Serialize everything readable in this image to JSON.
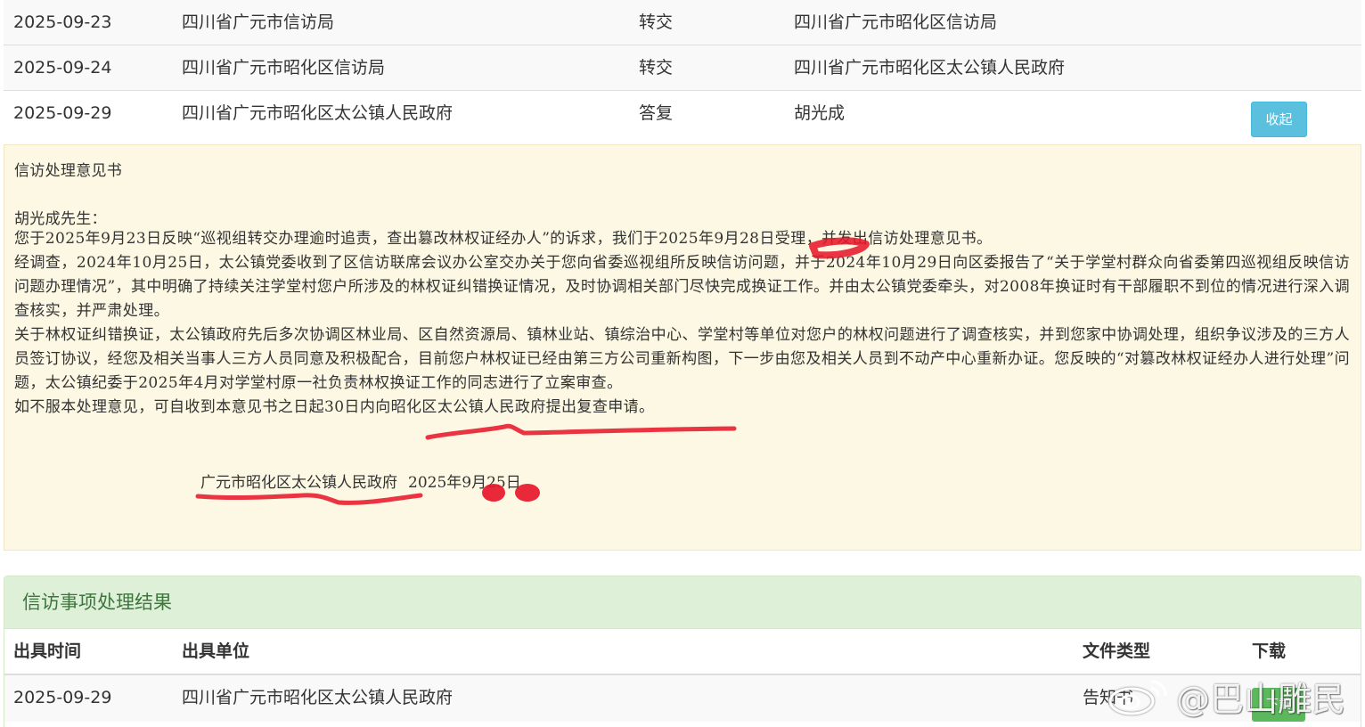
{
  "flow": {
    "rows": [
      {
        "date": "2025-09-23",
        "from": "四川省广元市信访局",
        "action": "转交",
        "to": "四川省广元市昭化区信访局"
      },
      {
        "date": "2025-09-24",
        "from": "四川省广元市昭化区信访局",
        "action": "转交",
        "to": "四川省广元市昭化区太公镇人民政府"
      },
      {
        "date": "2025-09-29",
        "from": "四川省广元市昭化区太公镇人民政府",
        "action": "答复",
        "to": "胡光成"
      }
    ],
    "collapse_label": "收起"
  },
  "opinion": {
    "title": "信访处理意见书",
    "salutation": "胡光成先生：",
    "paragraphs": [
      "您于2025年9月23日反映“巡视组转交办理逾时追责，查出篡改林权证经办人”的诉求，我们于2025年9月28日受理，并发出信访处理意见书。",
      "经调查，2024年10月25日，太公镇党委收到了区信访联席会议办公室交办关于您向省委巡视组所反映信访问题，并于2024年10月29日向区委报告了“关于学堂村群众向省委第四巡视组反映信访问题办理情况”，其中明确了持续关注学堂村您户所涉及的林权证纠错换证情况，及时协调相关部门尽快完成换证工作。并由太公镇党委牵头，对2008年换证时有干部履职不到位的情况进行深入调查核实，并严肃处理。",
      "关于林权证纠错换证，太公镇政府先后多次协调区林业局、区自然资源局、镇林业站、镇综治中心、学堂村等单位对您户的林权问题进行了调查核实，并到您家中协调处理，组织争议涉及的三方人员签订协议，经您及相关当事人三方人员同意及积极配合，目前您户林权证已经由第三方公司重新构图，下一步由您及相关人员到不动产中心重新办证。您反映的“对篡改林权证经办人进行处理”问题，太公镇纪委于2025年4月对学堂村原一社负责林权换证工作的同志进行了立案审查。",
      "如不服本处理意见，可自收到本意见书之日起30日内向昭化区太公镇人民政府提出复查申请。"
    ],
    "signature_org": "广元市昭化区太公镇人民政府",
    "signature_date": "2025年9月25日"
  },
  "result": {
    "heading": "信访事项处理结果",
    "columns": {
      "time": "出具时间",
      "org": "出具单位",
      "type": "文件类型",
      "download": "下载"
    },
    "rows": [
      {
        "time": "2025-09-29",
        "org": "四川省广元市昭化区太公镇人民政府",
        "type": "告知书",
        "download_label": "下载"
      }
    ]
  },
  "watermark": {
    "text": "@巴山雕民"
  },
  "colors": {
    "info_button": "#5bc0de",
    "success_button": "#5cb85c",
    "panel_warning_bg": "#fcf8e3",
    "panel_success_bg": "#dff0d8",
    "panel_success_text": "#3c763d",
    "marker_red": "#e8182b"
  }
}
